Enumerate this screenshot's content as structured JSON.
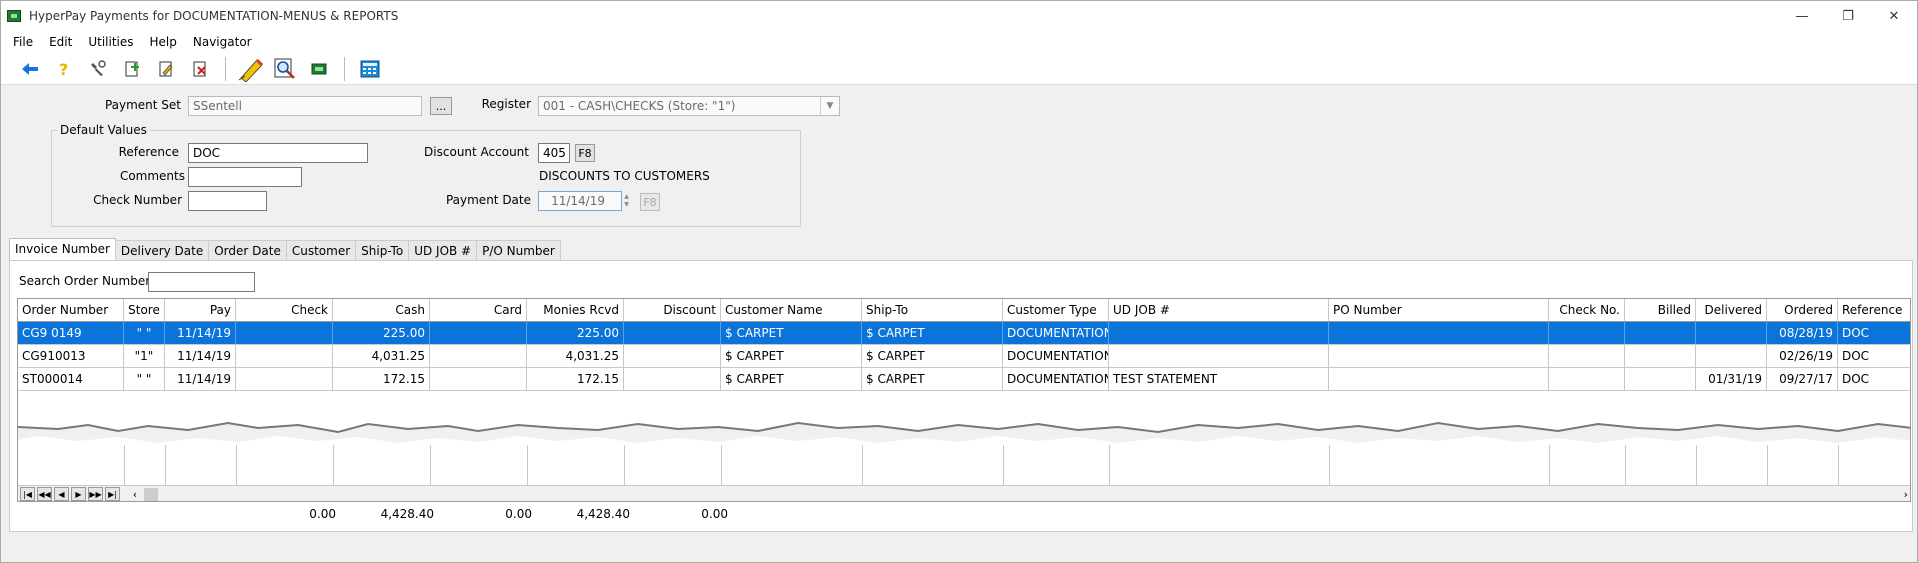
{
  "window": {
    "title": "HyperPay Payments for DOCUMENTATION-MENUS & REPORTS",
    "controls": [
      "—",
      "❐",
      "✕"
    ]
  },
  "menu": [
    "File",
    "Edit",
    "Utilities",
    "Help",
    "Navigator"
  ],
  "toolbar": {
    "icons": [
      "back-arrow-icon",
      "help-icon",
      "tools-icon",
      "add-record-icon",
      "edit-record-icon",
      "delete-record-icon",
      "pencil-icon",
      "magnifier-icon",
      "payment-icon",
      "calculator-icon"
    ]
  },
  "form": {
    "payment_set_label": "Payment Set",
    "payment_set_value": "SSentell",
    "payment_set_lookup": "...",
    "register_label": "Register",
    "register_value": "001 - CASH\\CHECKS (Store: \"1\")",
    "default_values_title": "Default Values",
    "reference_label": "Reference",
    "reference_value": "DOC",
    "comments_label": "Comments",
    "comments_value": "",
    "check_number_label": "Check Number",
    "check_number_value": "",
    "discount_account_label": "Discount Account",
    "discount_account_value": "405",
    "discount_account_f8": "F8",
    "discount_account_desc": "DISCOUNTS TO CUSTOMERS",
    "payment_date_label": "Payment Date",
    "payment_date_value": "11/14/19",
    "payment_date_f8": "F8"
  },
  "tabs": [
    "Invoice Number",
    "Delivery Date",
    "Order Date",
    "Customer",
    "Ship-To",
    "UD JOB #",
    "P/O Number"
  ],
  "search": {
    "label": "Search Order Number",
    "value": ""
  },
  "grid": {
    "columns": [
      "Order Number",
      "Store",
      "Pay",
      "Check",
      "Cash",
      "Card",
      "Monies Rcvd",
      "Discount",
      "Customer Name",
      "Ship-To",
      "Customer Type",
      "UD JOB #",
      "PO Number",
      "Check No.",
      "Billed",
      "Delivered",
      "Ordered",
      "Reference"
    ],
    "rows": [
      [
        "CG9 0149",
        "\" \"",
        "11/14/19",
        "",
        "225.00",
        "",
        "225.00",
        "",
        "$ CARPET",
        "$ CARPET",
        "DOCUMENTATION",
        "",
        "",
        "",
        "",
        "",
        "08/28/19",
        "DOC"
      ],
      [
        "CG910013",
        "\"1\"",
        "11/14/19",
        "",
        "4,031.25",
        "",
        "4,031.25",
        "",
        "$ CARPET",
        "$ CARPET",
        "DOCUMENTATION",
        "",
        "",
        "",
        "",
        "",
        "02/26/19",
        "DOC"
      ],
      [
        "ST000014",
        "\" \"",
        "11/14/19",
        "",
        "172.15",
        "",
        "172.15",
        "",
        "$ CARPET",
        "$ CARPET",
        "DOCUMENTATION",
        "TEST STATEMENT",
        "",
        "",
        "",
        "01/31/19",
        "09/27/17",
        "DOC"
      ]
    ],
    "navigator": [
      "|◀",
      "◀◀",
      "◀",
      "▶",
      "▶▶",
      "▶|"
    ]
  },
  "totals": {
    "check": "0.00",
    "cash": "4,428.40",
    "card": "0.00",
    "monies_rcvd": "4,428.40",
    "discount": "0.00"
  }
}
